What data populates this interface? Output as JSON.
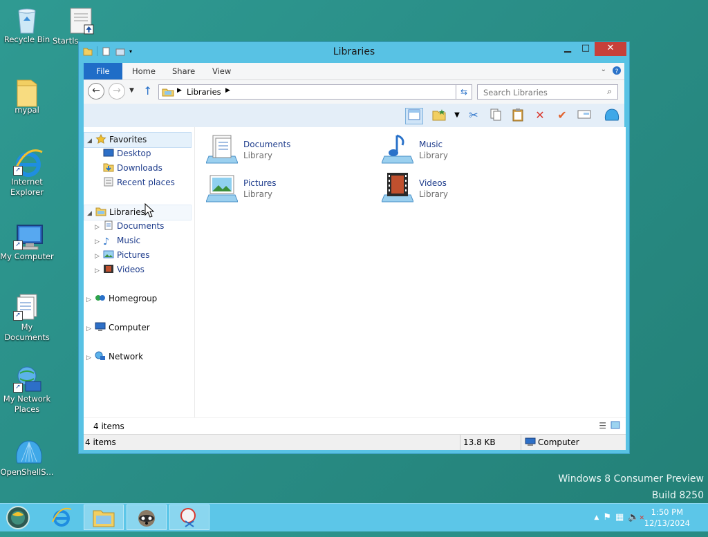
{
  "desktop_icons": [
    {
      "label": "Recycle Bin",
      "icon": "recycle-bin-icon"
    },
    {
      "label": "StartIs",
      "icon": "document-icon"
    },
    {
      "label": "mypal",
      "icon": "folder-icon"
    },
    {
      "label": "Internet Explorer",
      "icon": "internet-explorer-icon"
    },
    {
      "label": "My Computer",
      "icon": "computer-icon"
    },
    {
      "label": "My Documents",
      "icon": "documents-icon"
    },
    {
      "label": "My Network Places",
      "icon": "network-icon"
    },
    {
      "label": "OpenShellS...",
      "icon": "shell-icon"
    }
  ],
  "watermark": {
    "line1": "Windows 8 Consumer Preview",
    "line2": "Build 8250"
  },
  "window": {
    "title": "Libraries",
    "ribbon_tabs": {
      "file": "File",
      "home": "Home",
      "share": "Share",
      "view": "View"
    },
    "address": {
      "crumb": "Libraries"
    },
    "search": {
      "placeholder": "Search Libraries"
    },
    "nav": {
      "favorites": "Favorites",
      "desktop": "Desktop",
      "downloads": "Downloads",
      "recent": "Recent places",
      "libraries": "Libraries",
      "documents": "Documents",
      "music": "Music",
      "pictures": "Pictures",
      "videos": "Videos",
      "homegroup": "Homegroup",
      "computer": "Computer",
      "network": "Network"
    },
    "libraries": [
      {
        "name": "Documents",
        "kind": "Library"
      },
      {
        "name": "Music",
        "kind": "Library"
      },
      {
        "name": "Pictures",
        "kind": "Library"
      },
      {
        "name": "Videos",
        "kind": "Library"
      }
    ],
    "inner_status": "4 items",
    "status": {
      "items": "4 items",
      "size": "13.8 KB",
      "location": "Computer"
    }
  },
  "taskbar": {
    "time": "1:50 PM",
    "date": "12/13/2024"
  },
  "colors": {
    "accent": "#1f6dc7",
    "title_bar": "#58c2e4",
    "close": "#c7403a",
    "desktop": "#2a8f88"
  }
}
